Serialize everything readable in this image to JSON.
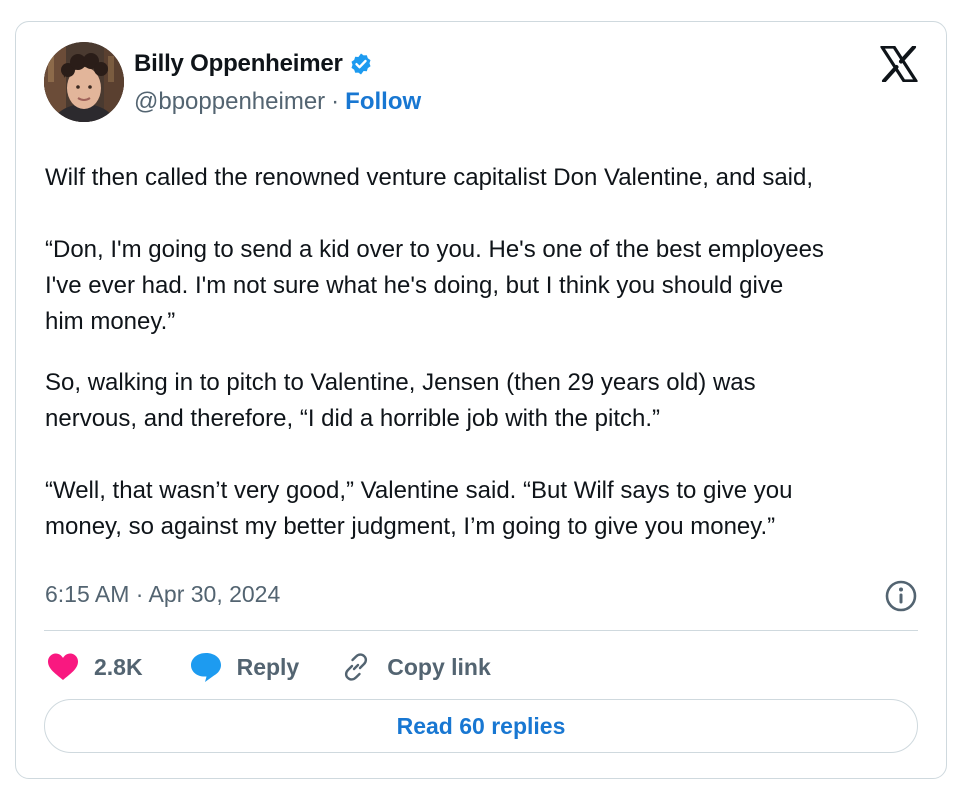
{
  "author": {
    "name": "Billy Oppenheimer",
    "handle": "@bpoppenheimer",
    "separator": "·",
    "follow_label": "Follow"
  },
  "icons": {
    "verified": "verified-badge-icon",
    "brand": "x-logo-icon",
    "info": "info-icon",
    "like": "heart-icon",
    "reply": "speech-bubble-icon",
    "copy": "link-icon"
  },
  "colors": {
    "accent": "#1d9bf0",
    "link_text": "#1877d2",
    "heart": "#f91880",
    "muted": "#536471",
    "border": "#cfd9de"
  },
  "tweet": {
    "paragraphs": [
      "Wilf then called the renowned venture capitalist Don Valentine, and said,",
      "“Don, I'm going to send a kid over to you. He's one of the best employees\nI've ever had. I'm not sure what he's doing, but I think you should give\nhim money.”",
      "So, walking in to pitch to Valentine, Jensen (then 29 years old) was\nnervous, and therefore, “I did a horrible job with the pitch.”",
      "“Well, that wasn’t very good,” Valentine said. “But Wilf says to give you\nmoney, so against my better judgment, I’m going to give you money.”"
    ],
    "timestamp": "6:15 AM · Apr 30, 2024"
  },
  "actions": {
    "likes": "2.8K",
    "reply_label": "Reply",
    "copy_label": "Copy link"
  },
  "read_replies_label": "Read 60 replies"
}
